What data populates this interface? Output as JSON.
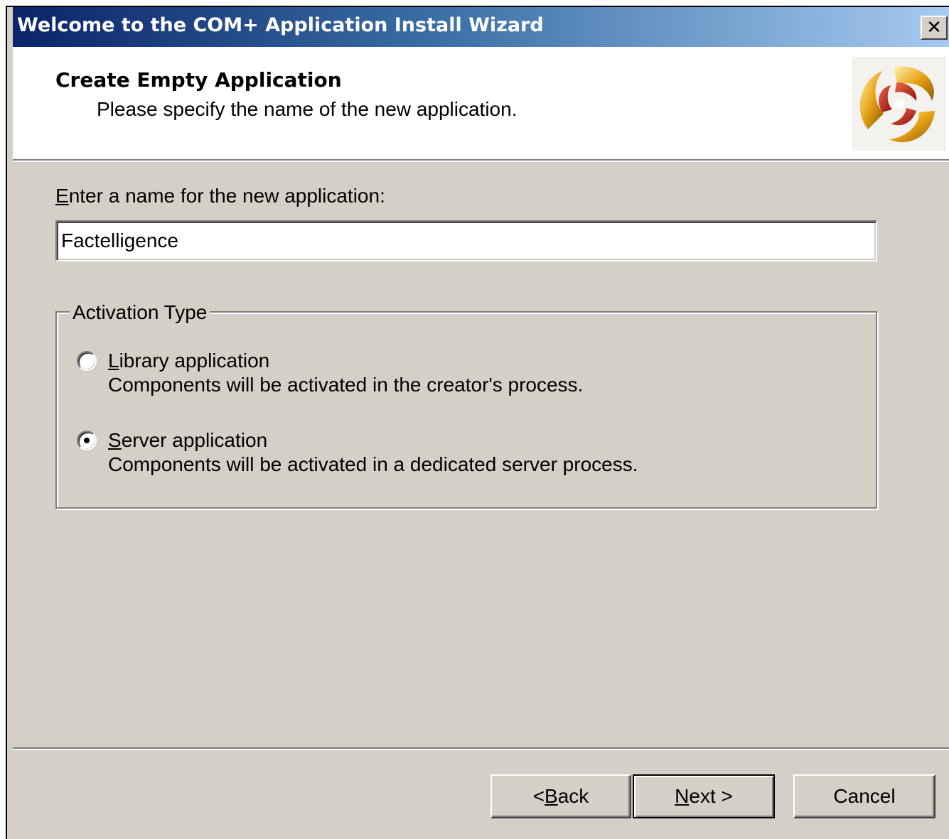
{
  "window": {
    "title": "Welcome to the COM+ Application Install Wizard",
    "close_symbol": "✕",
    "close_icon": "close-icon"
  },
  "header": {
    "title": "Create Empty Application",
    "subtitle": "Please specify the name of the new application.",
    "logo_icon": "com-plus-swirl-logo"
  },
  "name_field": {
    "label_first": "E",
    "label_rest": "nter a name for the new application:",
    "value": "Factelligence"
  },
  "activation": {
    "group_title": "Activation Type",
    "options": [
      {
        "label_first": "L",
        "label_rest": "ibrary application",
        "description": "Components will be activated in the creator's process.",
        "selected": false
      },
      {
        "label_first": "S",
        "label_rest": "erver application",
        "description": "Components will be activated in a dedicated server process.",
        "selected": true
      }
    ]
  },
  "buttons": {
    "back_prefix": "< ",
    "back_first": "B",
    "back_rest": "ack",
    "next_first": "N",
    "next_rest": "ext >",
    "cancel": "Cancel"
  },
  "colors": {
    "titlebar_start": "#0a246a",
    "titlebar_end": "#a6caf0",
    "dialog_face": "#d4d0c8",
    "logo_gold": "#e8a317",
    "logo_red": "#b5121b"
  }
}
